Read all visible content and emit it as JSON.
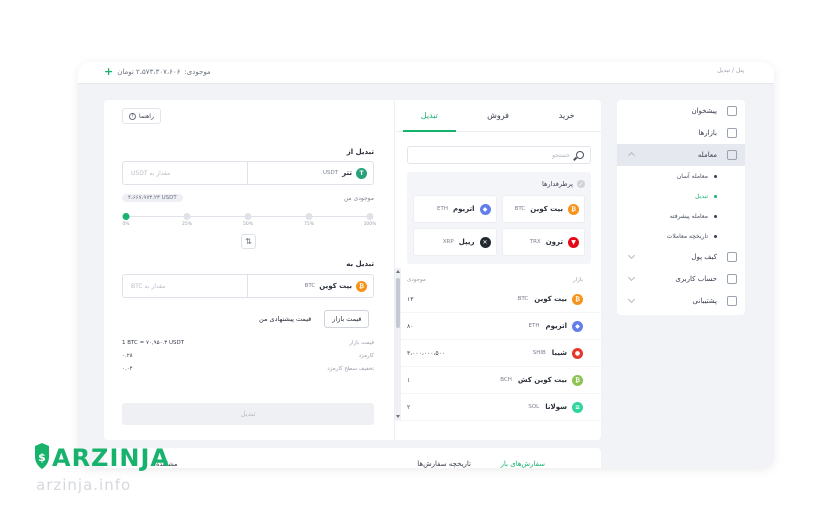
{
  "topbar": {
    "balance_label": "موجودی:",
    "balance_value": "۲،۵۷۳،۳۰۷،۶۰۶ تومان",
    "breadcrumb": "پنل / تبدیل"
  },
  "sidebar": {
    "items": [
      {
        "label": "پیشخوان"
      },
      {
        "label": "بازارها"
      },
      {
        "label": "معامله"
      },
      {
        "label": "کیف پول"
      },
      {
        "label": "حساب کاربری"
      },
      {
        "label": "پشتیبانی"
      }
    ],
    "subitems": [
      {
        "label": "معامله آسان"
      },
      {
        "label": "تبدیل"
      },
      {
        "label": "معامله پیشرفته"
      },
      {
        "label": "تاریخچه معاملات"
      }
    ]
  },
  "tabs": [
    {
      "label": "خرید"
    },
    {
      "label": "فروش"
    },
    {
      "label": "تبدیل"
    }
  ],
  "search": {
    "placeholder": "جستجو"
  },
  "favorites": {
    "title": "پرطرفدارها",
    "items": [
      {
        "name": "بیت کوین",
        "sym": "BTC",
        "color": "#f7931a",
        "glyph": "₿"
      },
      {
        "name": "اتریوم",
        "sym": "ETH",
        "color": "#627eea",
        "glyph": "◆"
      },
      {
        "name": "ترون",
        "sym": "TRX",
        "color": "#e50915",
        "glyph": "▼"
      },
      {
        "name": "ریپل",
        "sym": "XRP",
        "color": "#23292f",
        "glyph": "✕"
      }
    ]
  },
  "list": {
    "col_market": "بازار",
    "col_balance": "موجودی",
    "rows": [
      {
        "name": "بیت کوین",
        "sym": "BTC",
        "amount": "۱۳",
        "color": "#f7931a",
        "glyph": "₿"
      },
      {
        "name": "اتریوم",
        "sym": "ETH",
        "amount": "۸۰",
        "color": "#627eea",
        "glyph": "◆"
      },
      {
        "name": "شیبا",
        "sym": "SHIB",
        "amount": "۳،۰۰۰،۰۰۰،۵۰۰",
        "color": "#e4382b",
        "glyph": "●"
      },
      {
        "name": "بیت کوین کش",
        "sym": "BCH",
        "amount": "۱",
        "color": "#8dc351",
        "glyph": "₿"
      },
      {
        "name": "سولانا",
        "sym": "SOL",
        "amount": "۲",
        "color": "#2fd59a",
        "glyph": "≡"
      }
    ]
  },
  "convert": {
    "guide": "راهنما",
    "from_label": "تبدیل از",
    "from_name": "تتر",
    "from_sym": "USDT",
    "from_placeholder": "مقدار به USDT",
    "from_color": "#26a17b",
    "available_label": "موجودی من",
    "available_value": "۴،۶۶۷،۹۷۳.۲۳ USDT",
    "slider_ticks": [
      "0%",
      "25%",
      "50%",
      "75%",
      "100%"
    ],
    "slider_fraction": 0,
    "to_label": "تبدیل به",
    "to_name": "بیت کوین",
    "to_sym": "BTC",
    "to_placeholder": "مقدار به BTC",
    "to_color": "#f7931a",
    "market_price_btn": "قیمت بازار",
    "suggested_price_btn": "قیمت پیشنهادی من",
    "info": [
      {
        "label": "قیمت بازار",
        "value": "1 BTC = ۷۰,۹۵۰.۳ USDT"
      },
      {
        "label": "کارمزد",
        "value": "۰.۲۸"
      },
      {
        "label": "تخفیف سطح کارمزد",
        "value": "۰.۰۴"
      }
    ],
    "submit": "تبدیل"
  },
  "bottom": {
    "tab_open": "سفارش‌های باز",
    "tab_history": "تاریخچه سفارش‌ها",
    "left_text": "مشاهده"
  },
  "watermark": {
    "brand": "ARZINJA",
    "site": "arzinja.info"
  }
}
